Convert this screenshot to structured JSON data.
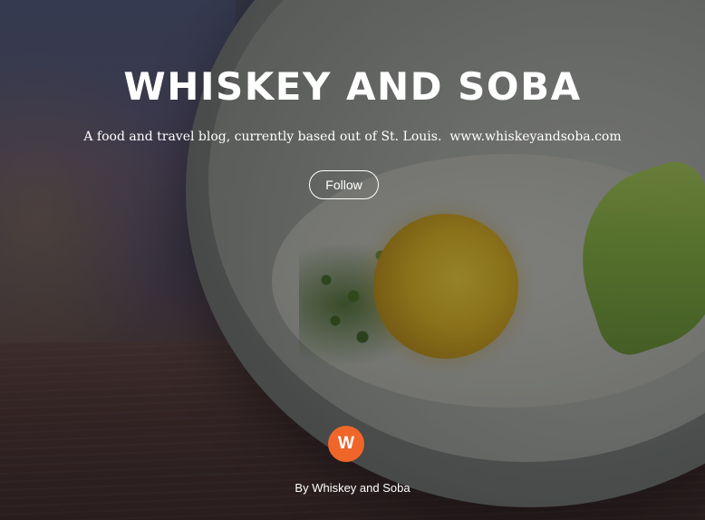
{
  "blog": {
    "title": "WHISKEY AND SOBA",
    "tagline": "A food and travel blog, currently based out of St. Louis.  www.whiskeyandsoba.com",
    "follow_label": "Follow",
    "avatar_letter": "W",
    "byline": "By Whiskey and Soba"
  },
  "colors": {
    "avatar_background": "#f0662a",
    "text": "#ffffff"
  },
  "hero_image": {
    "description_icon": "cover-photo"
  }
}
